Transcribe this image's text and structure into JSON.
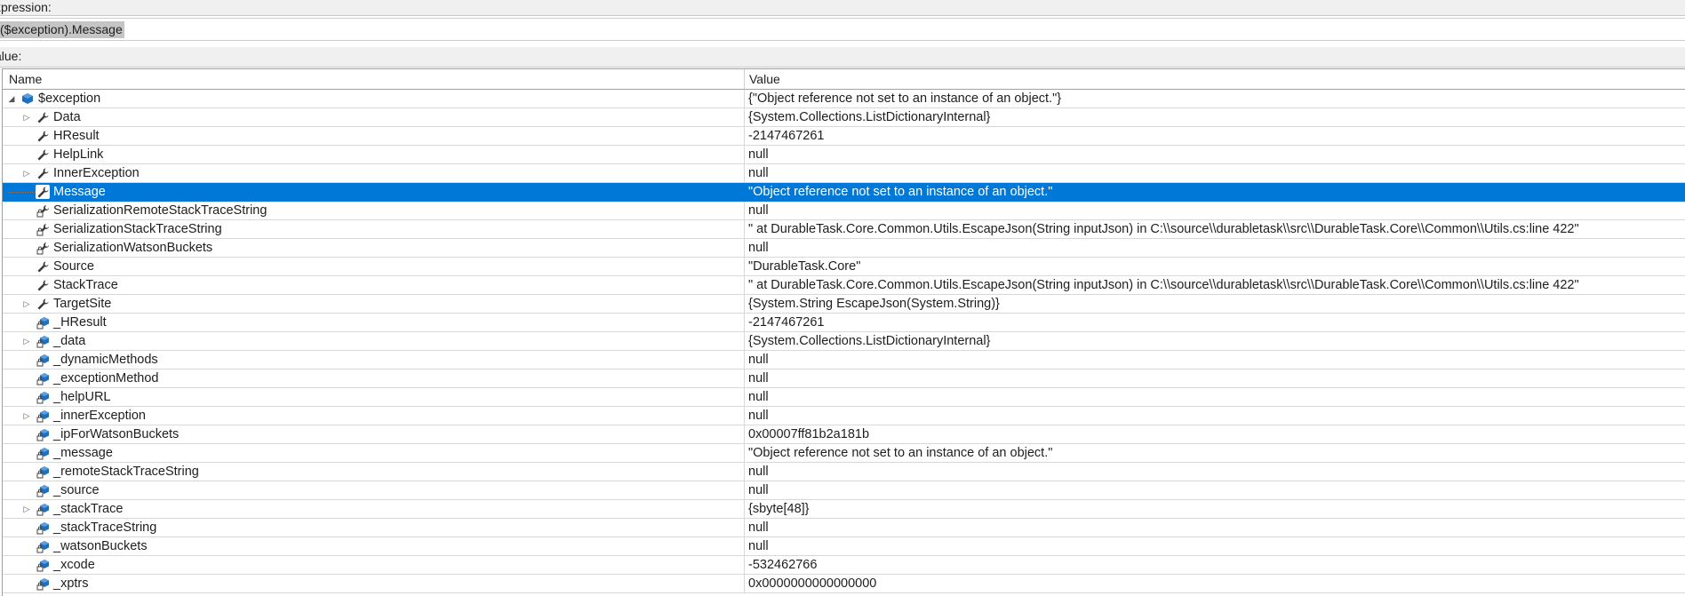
{
  "expression": {
    "label": "xpression:",
    "value": "($exception).Message"
  },
  "value_label": "alue:",
  "columns": {
    "name": "Name",
    "value": "Value"
  },
  "rows": [
    {
      "name": "$exception",
      "value": "{\"Object reference not set to an instance of an object.\"}",
      "level": 0,
      "expander": "expanded",
      "icon": "object-icon"
    },
    {
      "name": "Data",
      "value": "{System.Collections.ListDictionaryInternal}",
      "level": 1,
      "expander": "collapsed",
      "icon": "property-icon"
    },
    {
      "name": "HResult",
      "value": "-2147467261",
      "level": 1,
      "expander": "none",
      "icon": "property-icon"
    },
    {
      "name": "HelpLink",
      "value": "null",
      "level": 1,
      "expander": "none",
      "icon": "property-icon"
    },
    {
      "name": "InnerException",
      "value": "null",
      "level": 1,
      "expander": "collapsed",
      "icon": "property-icon"
    },
    {
      "name": "Message",
      "value": "\"Object reference not set to an instance of an object.\"",
      "level": 1,
      "expander": "none",
      "icon": "property-icon",
      "selected": true
    },
    {
      "name": "SerializationRemoteStackTraceString",
      "value": "null",
      "level": 1,
      "expander": "none",
      "icon": "private-property-icon"
    },
    {
      "name": "SerializationStackTraceString",
      "value": "\"   at DurableTask.Core.Common.Utils.EscapeJson(String inputJson) in C:\\\\source\\\\durabletask\\\\src\\\\DurableTask.Core\\\\Common\\\\Utils.cs:line 422\"",
      "level": 1,
      "expander": "none",
      "icon": "private-property-icon"
    },
    {
      "name": "SerializationWatsonBuckets",
      "value": "null",
      "level": 1,
      "expander": "none",
      "icon": "private-property-icon"
    },
    {
      "name": "Source",
      "value": "\"DurableTask.Core\"",
      "level": 1,
      "expander": "none",
      "icon": "property-icon"
    },
    {
      "name": "StackTrace",
      "value": "\"   at DurableTask.Core.Common.Utils.EscapeJson(String inputJson) in C:\\\\source\\\\durabletask\\\\src\\\\DurableTask.Core\\\\Common\\\\Utils.cs:line 422\"",
      "level": 1,
      "expander": "none",
      "icon": "property-icon"
    },
    {
      "name": "TargetSite",
      "value": "{System.String EscapeJson(System.String)}",
      "level": 1,
      "expander": "collapsed",
      "icon": "property-icon"
    },
    {
      "name": "_HResult",
      "value": "-2147467261",
      "level": 1,
      "expander": "none",
      "icon": "private-field-icon"
    },
    {
      "name": "_data",
      "value": "{System.Collections.ListDictionaryInternal}",
      "level": 1,
      "expander": "collapsed",
      "icon": "private-field-icon"
    },
    {
      "name": "_dynamicMethods",
      "value": "null",
      "level": 1,
      "expander": "none",
      "icon": "private-field-icon"
    },
    {
      "name": "_exceptionMethod",
      "value": "null",
      "level": 1,
      "expander": "none",
      "icon": "private-field-icon"
    },
    {
      "name": "_helpURL",
      "value": "null",
      "level": 1,
      "expander": "none",
      "icon": "private-field-icon"
    },
    {
      "name": "_innerException",
      "value": "null",
      "level": 1,
      "expander": "collapsed",
      "icon": "private-field-icon"
    },
    {
      "name": "_ipForWatsonBuckets",
      "value": "0x00007ff81b2a181b",
      "level": 1,
      "expander": "none",
      "icon": "private-field-icon"
    },
    {
      "name": "_message",
      "value": "\"Object reference not set to an instance of an object.\"",
      "level": 1,
      "expander": "none",
      "icon": "private-field-icon"
    },
    {
      "name": "_remoteStackTraceString",
      "value": "null",
      "level": 1,
      "expander": "none",
      "icon": "private-field-icon"
    },
    {
      "name": "_source",
      "value": "null",
      "level": 1,
      "expander": "none",
      "icon": "private-field-icon"
    },
    {
      "name": "_stackTrace",
      "value": "{sbyte[48]}",
      "level": 1,
      "expander": "collapsed",
      "icon": "private-field-icon"
    },
    {
      "name": "_stackTraceString",
      "value": "null",
      "level": 1,
      "expander": "none",
      "icon": "private-field-icon"
    },
    {
      "name": "_watsonBuckets",
      "value": "null",
      "level": 1,
      "expander": "none",
      "icon": "private-field-icon"
    },
    {
      "name": "_xcode",
      "value": "-532462766",
      "level": 1,
      "expander": "none",
      "icon": "private-field-icon"
    },
    {
      "name": "_xptrs",
      "value": "0x0000000000000000",
      "level": 1,
      "expander": "none",
      "icon": "private-field-icon"
    }
  ],
  "colors": {
    "selection": "#0078d7",
    "object_icon": "#1e6fbf",
    "property_icon": "#3c3c3c",
    "field_icon": "#1e6fbf"
  }
}
